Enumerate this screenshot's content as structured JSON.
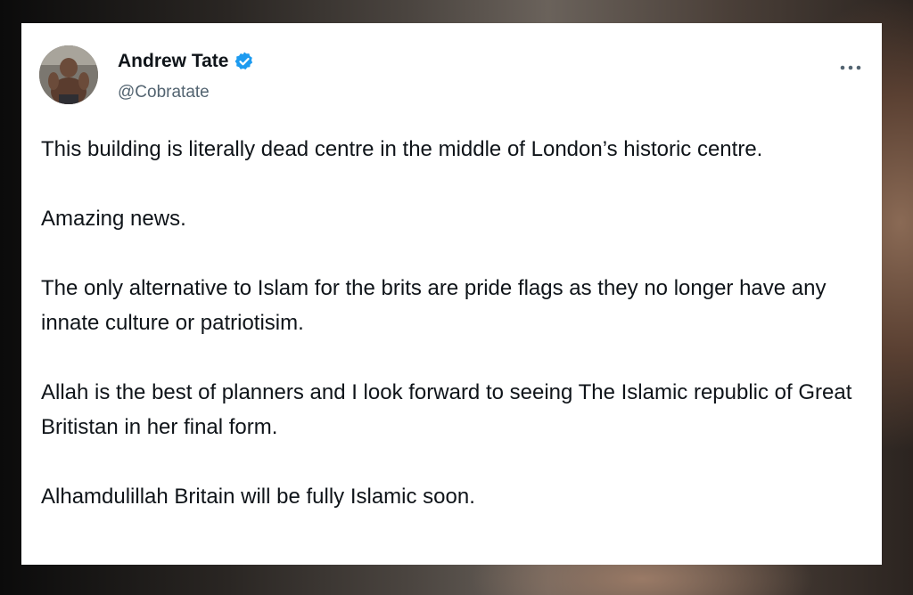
{
  "post": {
    "author_name": "Andrew Tate",
    "author_handle": "@Cobratate",
    "more_icon": "more-horizontal-icon",
    "verified_icon": "verified-badge-icon",
    "verified_color": "#1d9bf0",
    "paragraphs": [
      "This building is literally dead centre in the middle of London’s historic centre.",
      "Amazing news.",
      "The only alternative to Islam for the brits are pride flags as they no longer have any innate culture or patriotisim.",
      "Allah is the best of planners and I look forward to seeing The Islamic republic of Great Britistan in her final form.",
      "Alhamdulillah Britain will be fully Islamic soon."
    ]
  }
}
